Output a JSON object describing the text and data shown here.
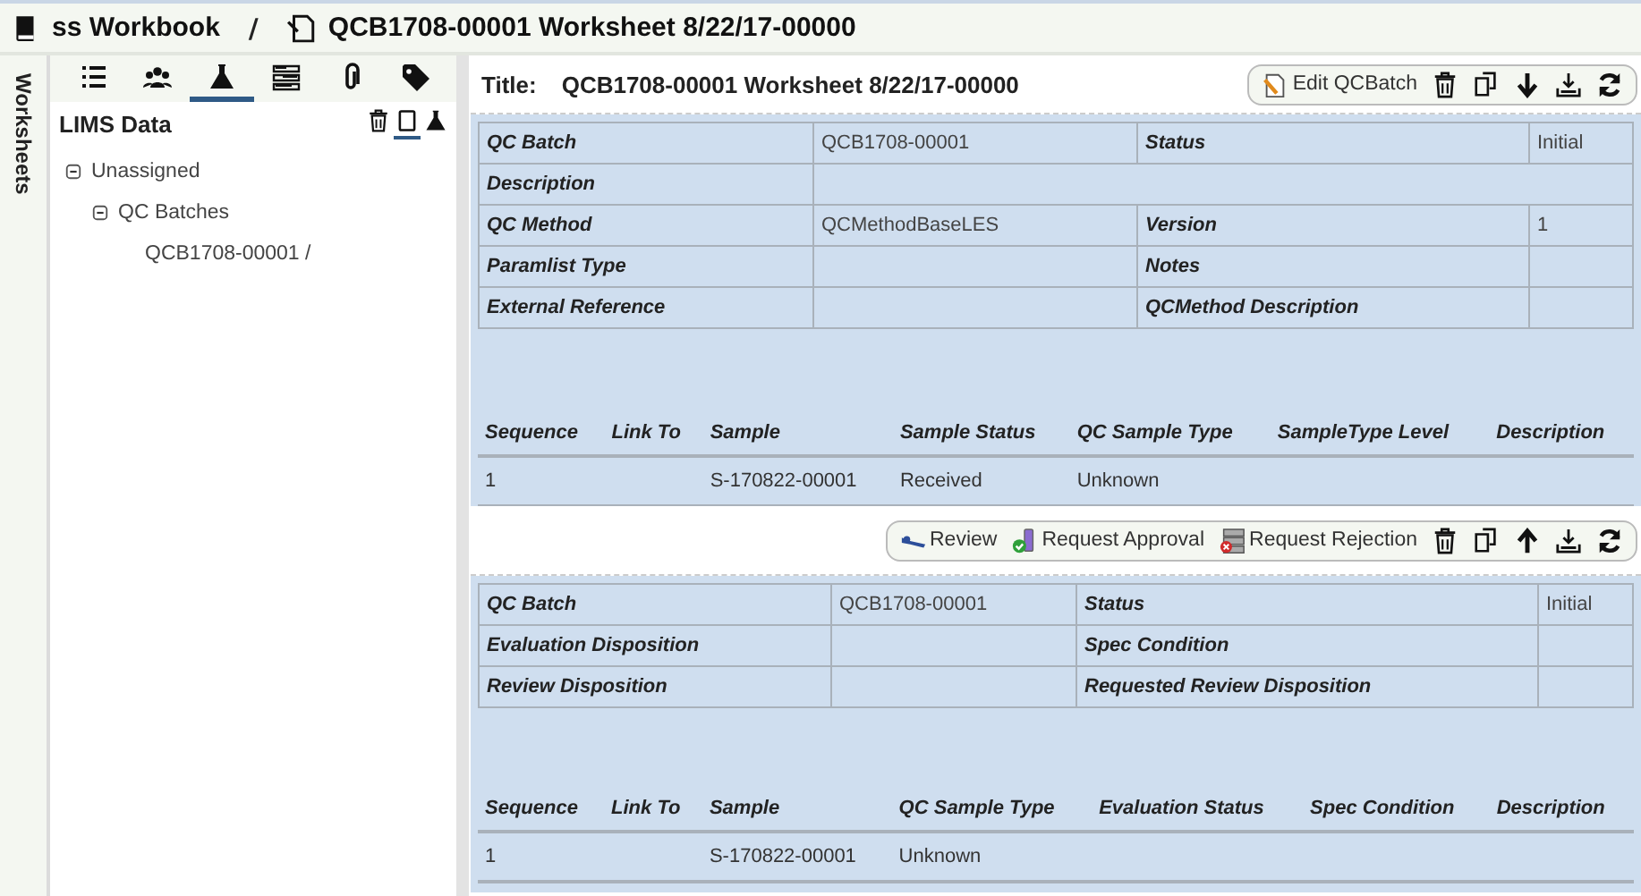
{
  "header": {
    "crumbs": [
      {
        "kind": "book",
        "label": "ss Workbook"
      },
      {
        "kind": "worksheet",
        "label": "QCB1708-00001 Worksheet 8/22/17-00000"
      }
    ],
    "separator": "/"
  },
  "side_tab": "Worksheets",
  "sidebar": {
    "tabs": [
      {
        "kind": "list",
        "selected": false
      },
      {
        "kind": "people",
        "selected": false
      },
      {
        "kind": "flask",
        "selected": true
      },
      {
        "kind": "fields",
        "selected": false
      },
      {
        "kind": "clip",
        "selected": false
      },
      {
        "kind": "tag",
        "selected": false
      }
    ],
    "title": "LIMS Data",
    "views": [
      {
        "kind": "trash",
        "selected": false
      },
      {
        "kind": "tablet",
        "selected": true
      },
      {
        "kind": "flask",
        "selected": false
      }
    ],
    "tree": [
      {
        "label": "Unassigned",
        "expanded": true,
        "children": [
          {
            "label": "QC Batches",
            "expanded": true,
            "children": [
              {
                "label": "QCB1708-00001 /"
              }
            ]
          }
        ]
      }
    ]
  },
  "sections": [
    {
      "title_label": "Title:",
      "title": "QCB1708-00001 Worksheet 8/22/17-00000",
      "actions": [
        {
          "kind": "edit",
          "label": "Edit QCBatch"
        },
        {
          "kind": "trash"
        },
        {
          "kind": "copy"
        },
        {
          "kind": "down"
        },
        {
          "kind": "download"
        },
        {
          "kind": "refresh"
        }
      ],
      "details": [
        [
          {
            "label": "QC Batch",
            "value": "QCB1708-00001"
          },
          {
            "label": "Status",
            "value": "Initial"
          }
        ],
        [
          {
            "label": "Description"
          }
        ],
        [
          {
            "label": "QC Method",
            "value": "QCMethodBaseLES"
          },
          {
            "label": "Version",
            "value": "1"
          }
        ],
        [
          {
            "label": "Paramlist Type"
          },
          {
            "label": "Notes"
          }
        ],
        [
          {
            "label": "External Reference"
          },
          {
            "label": "QCMethod Description"
          }
        ]
      ],
      "grid": {
        "columns": [
          "Sequence",
          "Link To",
          "Sample",
          "Sample Status",
          "QC Sample Type",
          "SampleType Level",
          "Description"
        ],
        "rows": [
          [
            "1",
            null,
            "S-170822-00001",
            "Received",
            "Unknown",
            null,
            null
          ]
        ]
      }
    },
    {
      "actions": [
        {
          "kind": "review",
          "label": "Review"
        },
        {
          "kind": "approve",
          "label": "Request Approval"
        },
        {
          "kind": "reject",
          "label": "Request Rejection"
        },
        {
          "kind": "trash"
        },
        {
          "kind": "copy"
        },
        {
          "kind": "up"
        },
        {
          "kind": "download"
        },
        {
          "kind": "refresh"
        }
      ],
      "details": [
        [
          {
            "label": "QC Batch",
            "value": "QCB1708-00001"
          },
          {
            "label": "Status",
            "value": "Initial"
          }
        ],
        [
          {
            "label": "Evaluation Disposition"
          },
          {
            "label": "Spec Condition"
          }
        ],
        [
          {
            "label": "Review Disposition"
          },
          {
            "label": "Requested Review Disposition"
          }
        ]
      ],
      "grid": {
        "columns": [
          "Sequence",
          "Link To",
          "Sample",
          "QC Sample Type",
          "Evaluation Status",
          "Spec Condition",
          "Description"
        ],
        "rows": [
          [
            "1",
            null,
            "S-170822-00001",
            "Unknown",
            null,
            null,
            null
          ]
        ]
      }
    }
  ]
}
